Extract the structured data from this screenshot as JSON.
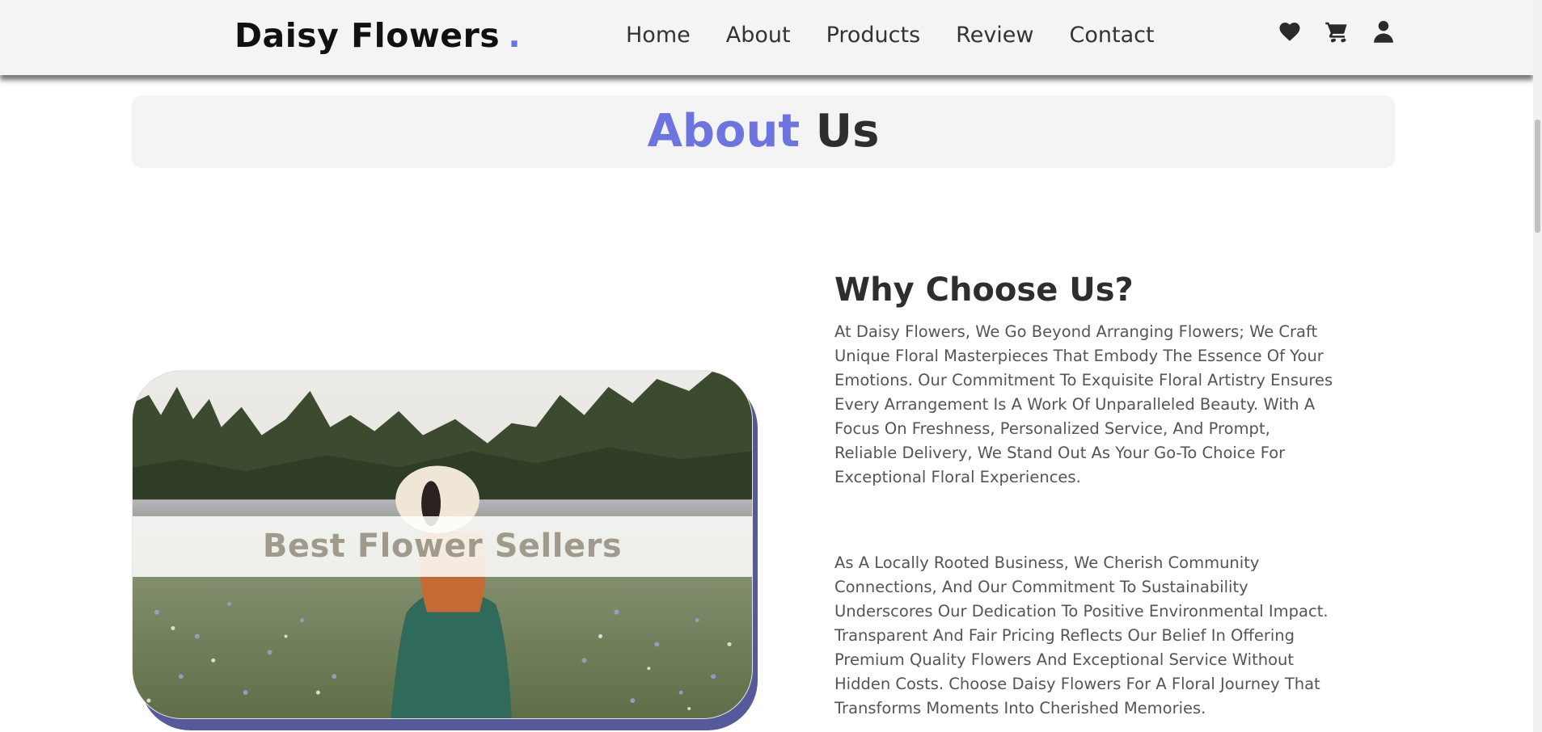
{
  "header": {
    "logo_text": "Daisy Flowers",
    "logo_dot": ".",
    "nav": [
      "Home",
      "About",
      "Products",
      "Review",
      "Contact"
    ],
    "icons": [
      "heart-icon",
      "cart-icon",
      "user-icon"
    ]
  },
  "section": {
    "title_accent": "About",
    "title_rest": "Us"
  },
  "card": {
    "caption": "Best Flower Sellers"
  },
  "why": {
    "title": "Why Choose Us?",
    "paragraphs": [
      "At Daisy Flowers, We Go Beyond Arranging Flowers; We Craft Unique Floral Masterpieces That Embody The Essence Of Your Emotions. Our Commitment To Exquisite Floral Artistry Ensures Every Arrangement Is A Work Of Unparalleled Beauty. With A Focus On Freshness, Personalized Service, And Prompt, Reliable Delivery, We Stand Out As Your Go-To Choice For Exceptional Floral Experiences.",
      "As A Locally Rooted Business, We Cherish Community Connections, And Our Commitment To Sustainability Underscores Our Dedication To Positive Environmental Impact. Transparent And Fair Pricing Reflects Our Belief In Offering Premium Quality Flowers And Exceptional Service Without Hidden Costs. Choose Daisy Flowers For A Floral Journey That Transforms Moments Into Cherished Memories."
    ]
  },
  "colors": {
    "accent": "#6c74e0",
    "card_shadow": "#565a9a",
    "header_bg": "#f4f4f4"
  }
}
